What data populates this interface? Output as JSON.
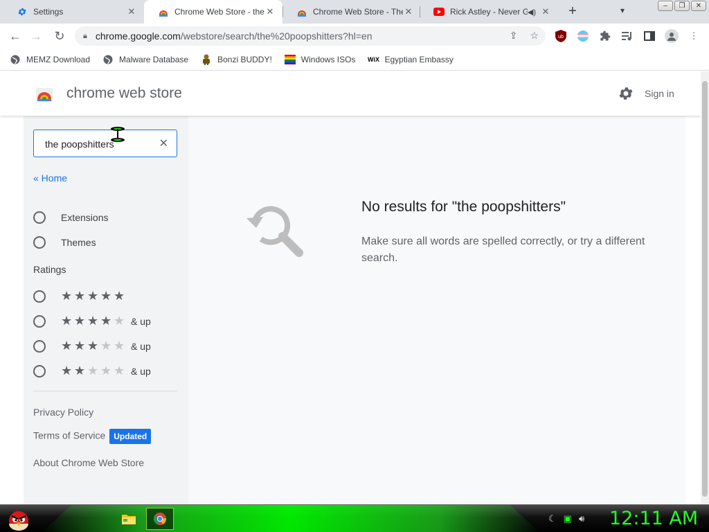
{
  "browser": {
    "tabs": [
      {
        "title": "Settings",
        "icon": "gear-icon",
        "active": false
      },
      {
        "title": "Chrome Web Store - the",
        "icon": "webstore-icon",
        "active": true
      },
      {
        "title": "Chrome Web Store - The",
        "icon": "webstore-icon",
        "active": false
      },
      {
        "title": "Rick Astley - Never G",
        "icon": "youtube-icon",
        "active": false
      }
    ],
    "new_tab": "+",
    "close_glyph": "✕",
    "url_host": "chrome.google.com",
    "url_path": "/webstore/search/the%20poopshitters?hl=en",
    "bookmarks": [
      {
        "label": "MEMZ Download",
        "icon": "globe-icon"
      },
      {
        "label": "Malware Database",
        "icon": "globe-icon"
      },
      {
        "label": "Bonzi BUDDY!",
        "icon": "bonzi-icon"
      },
      {
        "label": "Windows ISOs",
        "icon": "rainbow-flag-icon"
      },
      {
        "label": "Egyptian Embassy",
        "icon": "wix-icon"
      }
    ],
    "wix_text": "WiX"
  },
  "store": {
    "title": "chrome web store",
    "sign_in": "Sign in",
    "search_value": "the poopshitters",
    "clear_glyph": "✕",
    "home_link": "« Home",
    "categories": [
      "Extensions",
      "Themes"
    ],
    "ratings_heading": "Ratings",
    "ratings": [
      {
        "stars": 5,
        "suffix": ""
      },
      {
        "stars": 4,
        "suffix": "& up"
      },
      {
        "stars": 3,
        "suffix": "& up"
      },
      {
        "stars": 2,
        "suffix": "& up"
      }
    ],
    "footer": {
      "privacy": "Privacy Policy",
      "terms": "Terms of Service",
      "terms_badge": "Updated",
      "about": "About Chrome Web Store"
    },
    "no_results_title": "No results for \"the poopshitters\"",
    "no_results_text": "Make sure all words are spelled correctly, or try a different search."
  },
  "taskbar": {
    "clock": "12:11 AM"
  },
  "colors": {
    "accent": "#1a73e8",
    "clock": "#22ff22"
  }
}
